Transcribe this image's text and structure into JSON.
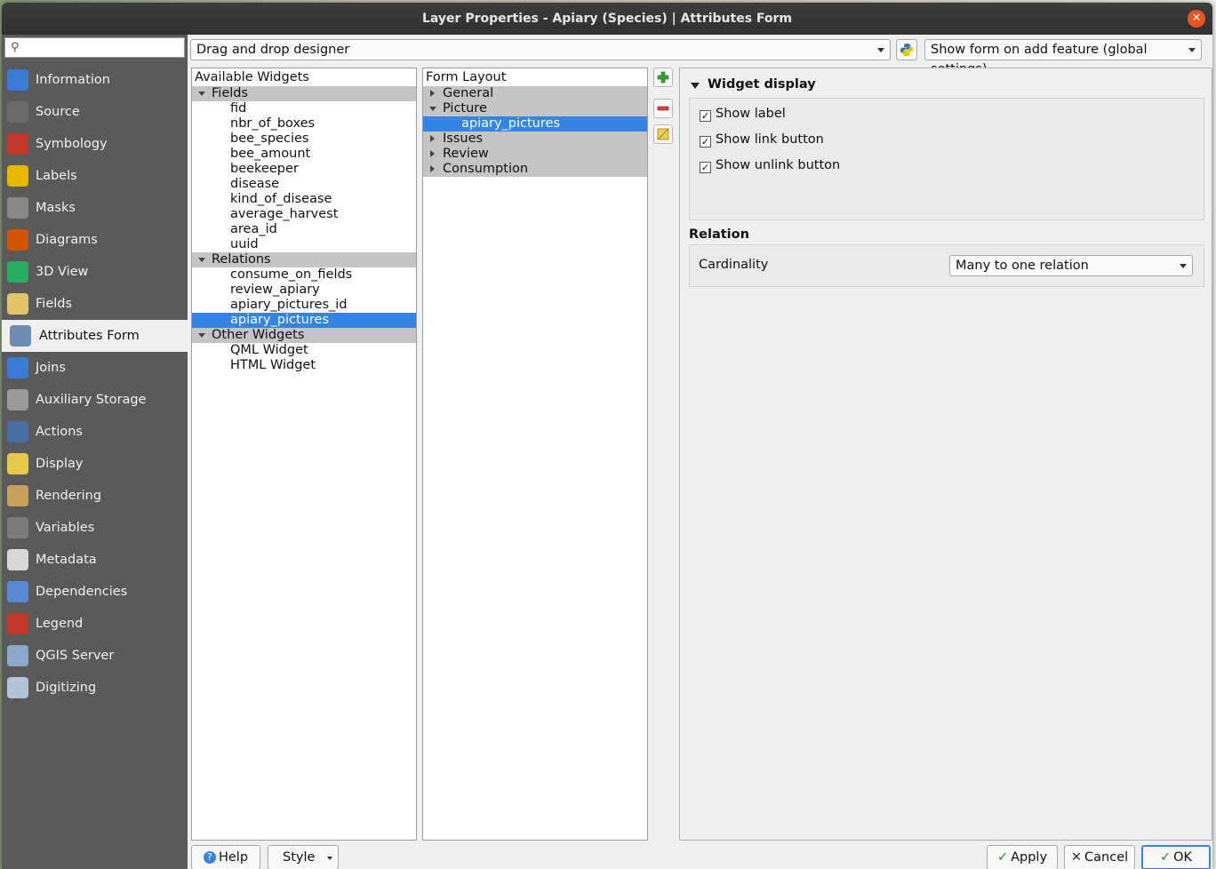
{
  "window": {
    "title": "Layer Properties - Apiary (Species) | Attributes Form"
  },
  "search": {
    "placeholder": ""
  },
  "sidebar": {
    "items": [
      {
        "label": "Information",
        "icon": "info-icon",
        "color": "#3a7bd5"
      },
      {
        "label": "Source",
        "icon": "wrench-icon",
        "color": "#6b6b6b"
      },
      {
        "label": "Symbology",
        "icon": "paintbrush-icon",
        "color": "#c0392b"
      },
      {
        "label": "Labels",
        "icon": "abc-label-icon",
        "color": "#e6b800"
      },
      {
        "label": "Masks",
        "icon": "abc-mask-icon",
        "color": "#888888"
      },
      {
        "label": "Diagrams",
        "icon": "diagram-icon",
        "color": "#d35400"
      },
      {
        "label": "3D View",
        "icon": "cube-icon",
        "color": "#27ae60"
      },
      {
        "label": "Fields",
        "icon": "fields-icon",
        "color": "#e1c46a"
      },
      {
        "label": "Attributes Form",
        "icon": "form-icon",
        "color": "#6a8caf"
      },
      {
        "label": "Joins",
        "icon": "join-icon",
        "color": "#3a7bd5"
      },
      {
        "label": "Auxiliary Storage",
        "icon": "database-icon",
        "color": "#9a9a9a"
      },
      {
        "label": "Actions",
        "icon": "gear-icon",
        "color": "#4a6fa5"
      },
      {
        "label": "Display",
        "icon": "speech-bubble-icon",
        "color": "#e6c84a"
      },
      {
        "label": "Rendering",
        "icon": "brush-icon",
        "color": "#c8a05a"
      },
      {
        "label": "Variables",
        "icon": "epsilon-icon",
        "color": "#7a7a7a"
      },
      {
        "label": "Metadata",
        "icon": "metadata-icon",
        "color": "#d8d8d8"
      },
      {
        "label": "Dependencies",
        "icon": "dependencies-icon",
        "color": "#5a8ad5"
      },
      {
        "label": "Legend",
        "icon": "legend-icon",
        "color": "#c0392b"
      },
      {
        "label": "QGIS Server",
        "icon": "server-icon",
        "color": "#8aa8c8"
      },
      {
        "label": "Digitizing",
        "icon": "digitizing-icon",
        "color": "#b0c4d8"
      }
    ]
  },
  "toolbar": {
    "designer_mode": "Drag and drop designer",
    "form_suppress": "Show form on add feature (global settings)"
  },
  "available_widgets": {
    "header": "Available Widgets",
    "fields_label": "Fields",
    "fields": [
      "fid",
      "nbr_of_boxes",
      "bee_species",
      "bee_amount",
      "beekeeper",
      "disease",
      "kind_of_disease",
      "average_harvest",
      "area_id",
      "uuid"
    ],
    "relations_label": "Relations",
    "relations": [
      "consume_on_fields",
      "review_apiary",
      "apiary_pictures_id",
      "apiary_pictures"
    ],
    "other_label": "Other Widgets",
    "other": [
      "QML Widget",
      "HTML Widget"
    ]
  },
  "form_layout": {
    "header": "Form Layout",
    "groups": [
      "General",
      "Picture",
      "Issues",
      "Review",
      "Consumption"
    ],
    "picture_child": "apiary_pictures"
  },
  "widget_display": {
    "title": "Widget display",
    "show_label": "Show label",
    "show_link": "Show link button",
    "show_unlink": "Show unlink button"
  },
  "relation": {
    "title": "Relation",
    "cardinality_label": "Cardinality",
    "cardinality_value": "Many to one relation"
  },
  "buttons": {
    "help": "Help",
    "style": "Style",
    "apply": "Apply",
    "cancel": "Cancel",
    "ok": "OK"
  },
  "colors": {
    "selection": "#3584e4",
    "sidebar_bg": "#5a5a5a",
    "title_bg": "#303030"
  }
}
